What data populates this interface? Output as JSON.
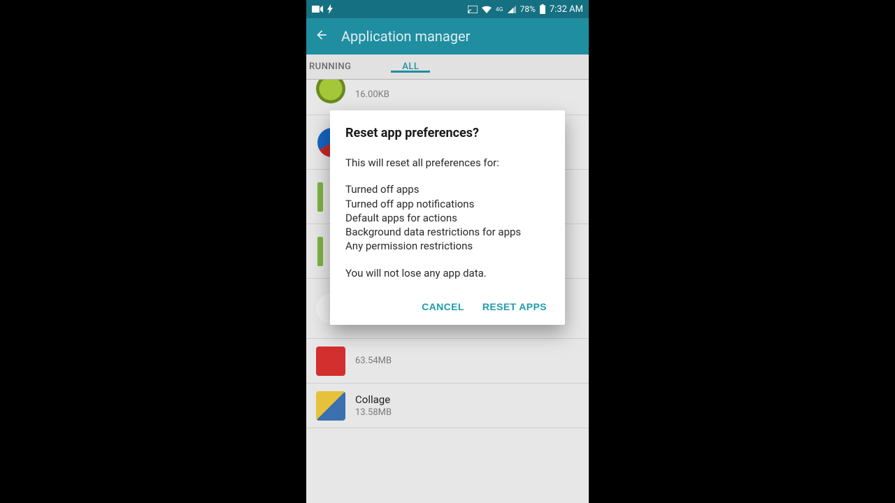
{
  "statusbar": {
    "battery_pct": "78%",
    "time": "7:32 AM"
  },
  "appbar": {
    "title": "Application manager"
  },
  "tabs": {
    "running": "RUNNING",
    "all": "ALL"
  },
  "apps": {
    "first_size": "16.00KB",
    "row_mid_size": "63.54MB",
    "collage_name": "Collage",
    "collage_size": "13.58MB"
  },
  "dialog": {
    "title": "Reset app preferences?",
    "intro": "This will reset all preferences for:",
    "items": [
      "Turned off apps",
      "Turned off app notifications",
      "Default apps for actions",
      "Background data restrictions for apps",
      "Any permission restrictions"
    ],
    "footer": "You will not lose any app data.",
    "cancel": "CANCEL",
    "reset": "RESET APPS"
  }
}
